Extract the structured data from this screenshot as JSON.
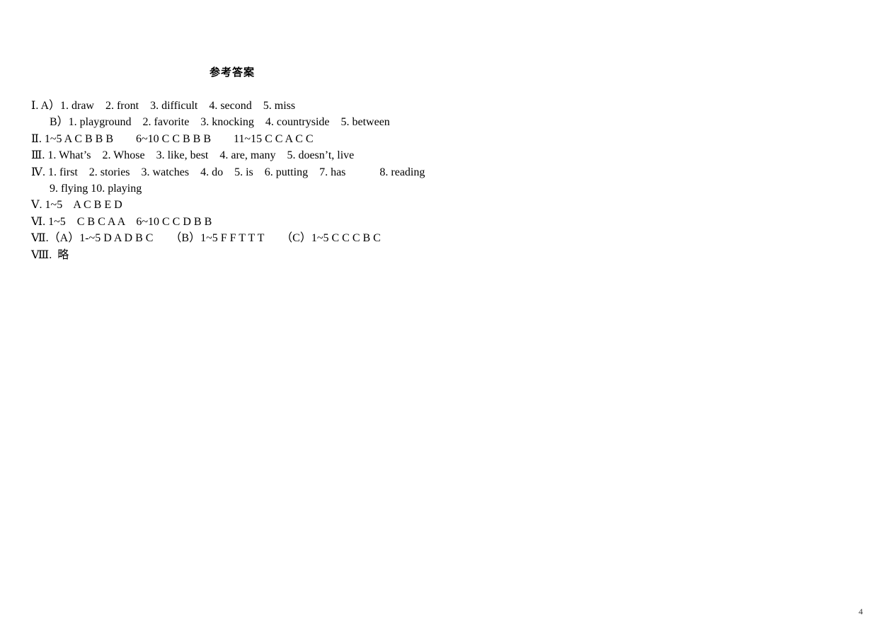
{
  "document": {
    "title": "参考答案",
    "page_number": "4",
    "lines": [
      {
        "id": "sec-1-a",
        "numeral": "Ⅰ",
        "text": "Ⅰ. A）1. draw    2. front    3. difficult    4. second    5. miss",
        "indented": false
      },
      {
        "id": "sec-1-b",
        "numeral": "",
        "text": "B）1. playground    2. favorite    3. knocking    4. countryside    5. between",
        "indented": true
      },
      {
        "id": "sec-2",
        "numeral": "Ⅱ",
        "text": "Ⅱ. 1~5 A C B B B        6~10 C C B B B        11~15 C C A C C",
        "indented": false
      },
      {
        "id": "sec-3",
        "numeral": "Ⅲ",
        "text": "Ⅲ. 1. What’s    2. Whose    3. like, best    4. are, many    5. doesn’t, live",
        "indented": false
      },
      {
        "id": "sec-4-a",
        "numeral": "Ⅳ",
        "text": "Ⅳ. 1. first    2. stories    3. watches    4. do    5. is    6. putting    7. has            8. reading",
        "indented": false
      },
      {
        "id": "sec-4-b",
        "numeral": "",
        "text": "9. flying 10. playing",
        "indented": true
      },
      {
        "id": "sec-5",
        "numeral": "Ⅴ",
        "text": "Ⅴ. 1~5    A C B E D",
        "indented": false
      },
      {
        "id": "sec-6",
        "numeral": "Ⅵ",
        "text": "Ⅵ. 1~5    C B C A A    6~10 C C D B B",
        "indented": false
      },
      {
        "id": "sec-7",
        "numeral": "Ⅶ",
        "text": "Ⅶ.（A）1-~5 D A D B C      （B）1~5 F F T T T      （C）1~5 C C C B C",
        "indented": false
      },
      {
        "id": "sec-8",
        "numeral": "Ⅷ",
        "text": "Ⅷ.  略",
        "indented": false
      }
    ]
  }
}
